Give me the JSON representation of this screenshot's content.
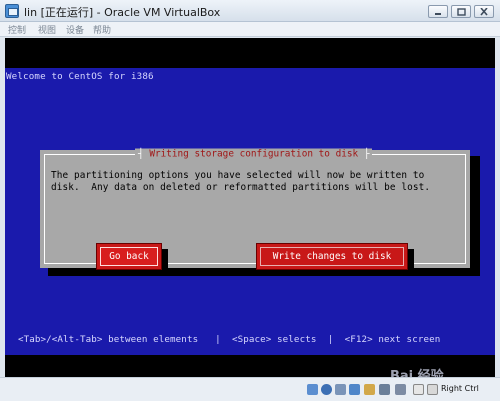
{
  "window": {
    "title": "lin [正在运行] - Oracle VM VirtualBox",
    "menu": [
      "控制",
      "视图",
      "设备",
      "帮助"
    ]
  },
  "screen": {
    "welcome": "Welcome to CentOS for i386",
    "dialog": {
      "title": "Writing storage configuration to disk",
      "message_line1": "The partitioning options you have selected will now be written to",
      "message_line2": "disk.  Any data on deleted or reformatted partitions will be lost.",
      "go_back_label": "Go back",
      "write_label": "Write changes to disk"
    },
    "hint": "<Tab>/<Alt-Tab> between elements   |  <Space> selects  |  <F12> next screen"
  },
  "statusbar": {
    "host_key": "Right Ctrl",
    "icons": [
      "hard-disk-icon",
      "optical-drive-icon",
      "usb-icon",
      "network-icon",
      "shared-folder-icon",
      "display-icon",
      "capture-icon",
      "mouse-integration-icon",
      "keyboard-capture-icon"
    ]
  },
  "watermark": "Bai 经验",
  "colors": {
    "screen_blue": "#1a1aac",
    "dialog_gray": "#a8a8a8",
    "button_red": "#c81818",
    "title_red": "#a01818"
  }
}
